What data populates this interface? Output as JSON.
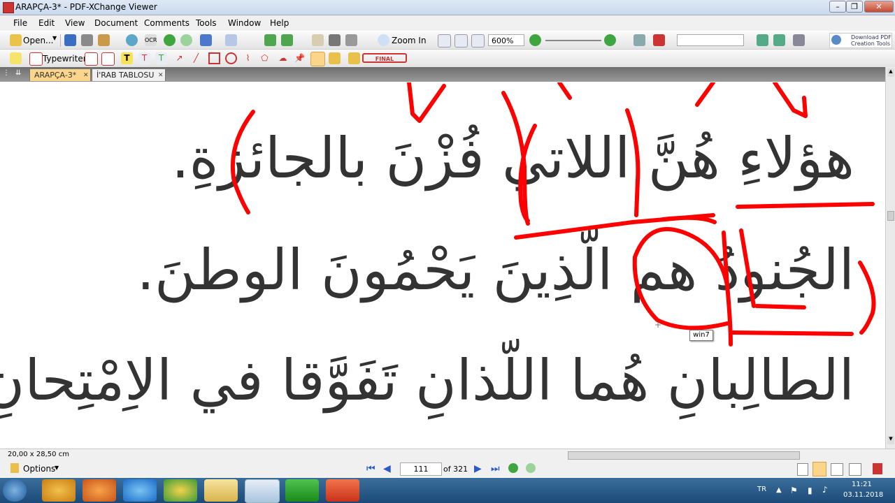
{
  "window": {
    "title": "ARAPÇA-3* - PDF-XChange Viewer"
  },
  "menu": [
    "File",
    "Edit",
    "View",
    "Document",
    "Comments",
    "Tools",
    "Window",
    "Help"
  ],
  "toolbar1": {
    "open_label": "Open...",
    "zoom_in_label": "Zoom In",
    "zoom_value": "600%",
    "download_label_line1": "Download PDF",
    "download_label_line2": "Creation Tools"
  },
  "toolbar2": {
    "typewriter_label": "Typewriter",
    "stamp_label": "FINAL"
  },
  "tabs": [
    {
      "label": "ARAPÇA-3*",
      "active": true
    },
    {
      "label": "İ'RAB TABLOSU",
      "active": false
    }
  ],
  "document": {
    "lines": [
      "هؤلاءِ هُنَّ اللاتي فُزْنَ بالجائزةِ.",
      "الجُنودُ هم الّذِينَ يَحْمُونَ الوطنَ.",
      "الطالِبانِ هُما اللّذانِ تَفَوَّقا في الاِمْتِحانِ."
    ],
    "tooltip": "win7",
    "annotation_color": "#ff0000"
  },
  "status": {
    "page_size": "20,00 x 28,50 cm"
  },
  "nav": {
    "options_label": "Options",
    "current_page": "111",
    "of_pages": "of 321"
  },
  "taskbar": {
    "lang": "TR",
    "time": "11:21",
    "date": "03.11.2018"
  }
}
